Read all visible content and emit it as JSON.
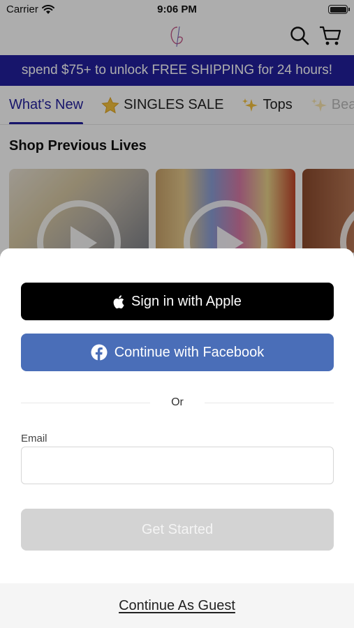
{
  "status_bar": {
    "carrier": "Carrier",
    "time": "9:06 PM"
  },
  "header": {
    "logo_icon": "store-logo-icon",
    "search_icon": "search-icon",
    "cart_icon": "cart-icon"
  },
  "promo_banner": {
    "text": "spend $75+ to unlock FREE SHIPPING for 24 hours!"
  },
  "tabs": [
    {
      "label": "What's New",
      "active": true
    },
    {
      "label": "SINGLES SALE",
      "icon": "star-icon"
    },
    {
      "label": "Tops",
      "icon": "sparkles-icon"
    },
    {
      "label": "Bea",
      "icon": "sparkles-icon"
    }
  ],
  "previous_lives": {
    "title": "Shop Previous Lives"
  },
  "auth_sheet": {
    "apple_button": "Sign in with Apple",
    "facebook_button": "Continue with Facebook",
    "divider_text": "Or",
    "email_label": "Email",
    "email_value": "",
    "email_placeholder": "",
    "submit_button": "Get Started",
    "guest_link": "Continue As Guest"
  },
  "colors": {
    "brand": "#221f9e",
    "facebook": "#4a6eb8",
    "apple": "#000000",
    "disabled": "#d3d3d3"
  }
}
